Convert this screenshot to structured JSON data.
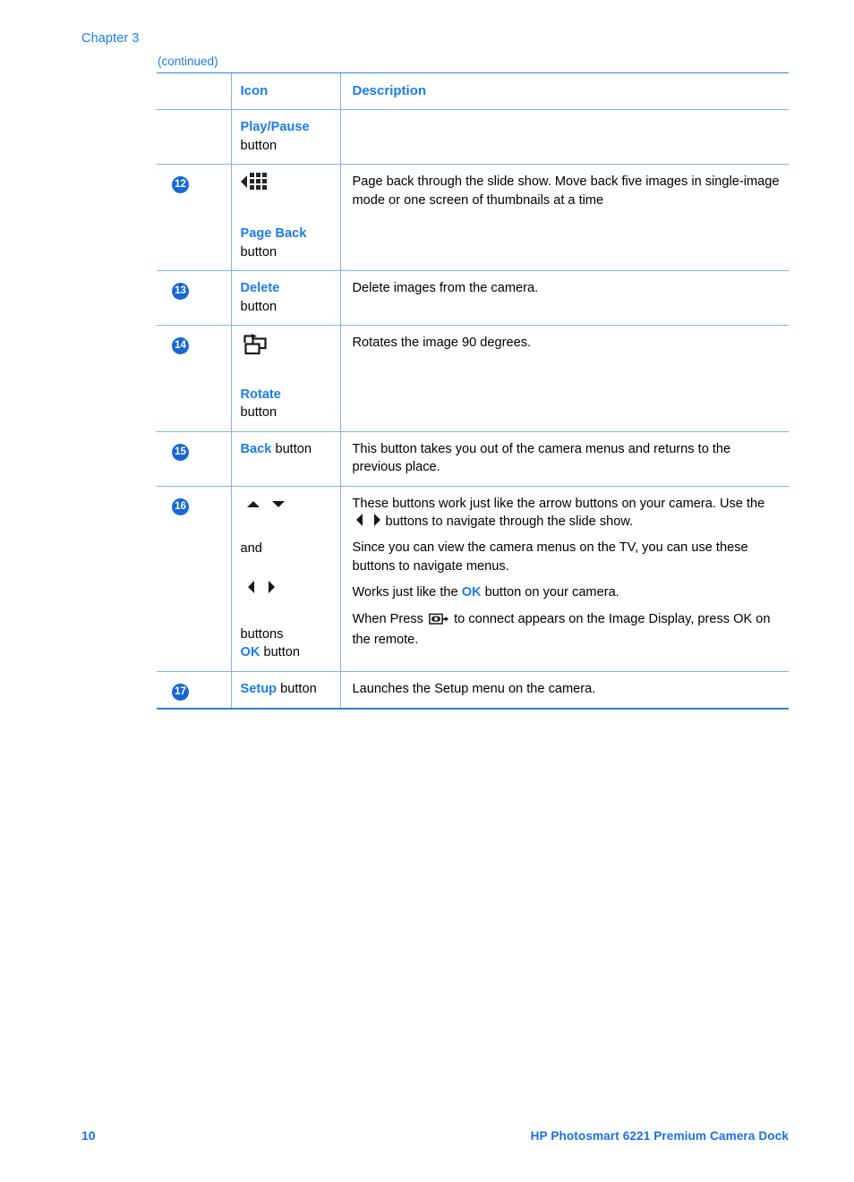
{
  "header": {
    "chapter": "Chapter 3",
    "continued": "(continued)"
  },
  "table": {
    "columns": {
      "number": "",
      "icon": "Icon",
      "description": "Description"
    },
    "rows": [
      {
        "number": "",
        "icon_label_blue": "Play/Pause",
        "icon_label_plain": "button",
        "icon_glyph": "",
        "description": ""
      },
      {
        "number": "12",
        "icon_label_blue": "Page Back",
        "icon_label_plain": "button",
        "icon_glyph": "page-back-icon",
        "description": "Page back through the slide show. Move back five images in single-image mode or one screen of thumbnails at a time"
      },
      {
        "number": "13",
        "icon_label_blue": "Delete",
        "icon_label_plain": "button",
        "icon_glyph": "",
        "description": "Delete images from the camera."
      },
      {
        "number": "14",
        "icon_label_blue": "Rotate",
        "icon_label_plain": "button",
        "icon_glyph": "rotate-icon",
        "description": "Rotates the image 90 degrees."
      },
      {
        "number": "15",
        "icon_label_blue": "Back",
        "icon_label_plain": "button",
        "icon_glyph": "",
        "description": "This button takes you out of the camera menus and returns to the previous place."
      },
      {
        "number": "16",
        "icon_glyph": "arrow-buttons-icon",
        "icon_conjunction": "and",
        "icon_label_plain": "buttons",
        "icon_label_blue2": "OK",
        "icon_label_plain2": "button",
        "desc_p1_a": "These buttons work just like the arrow buttons on your camera. Use the",
        "desc_p1_b": "buttons to navigate through the slide show.",
        "desc_p2": "Since you can view the camera menus on the TV, you can use these buttons to navigate menus.",
        "desc_p3_a": "Works just like the",
        "desc_p3_ok": "OK",
        "desc_p3_b": "button on your camera.",
        "desc_p4_a": "When Press",
        "desc_p4_b": "to connect appears on the Image Display, press OK on the remote."
      },
      {
        "number": "17",
        "icon_label_blue": "Setup",
        "icon_label_plain": "button",
        "icon_glyph": "",
        "description": "Launches the Setup menu on the camera."
      }
    ]
  },
  "footer": {
    "page_number": "10",
    "product_title": "HP Photosmart 6221 Premium Camera Dock"
  },
  "colors": {
    "accent_blue": "#1a7cf0",
    "badge_blue": "#1668d6",
    "rule_blue": "#7fb3f0",
    "rule_strong": "#2f7fe0"
  }
}
